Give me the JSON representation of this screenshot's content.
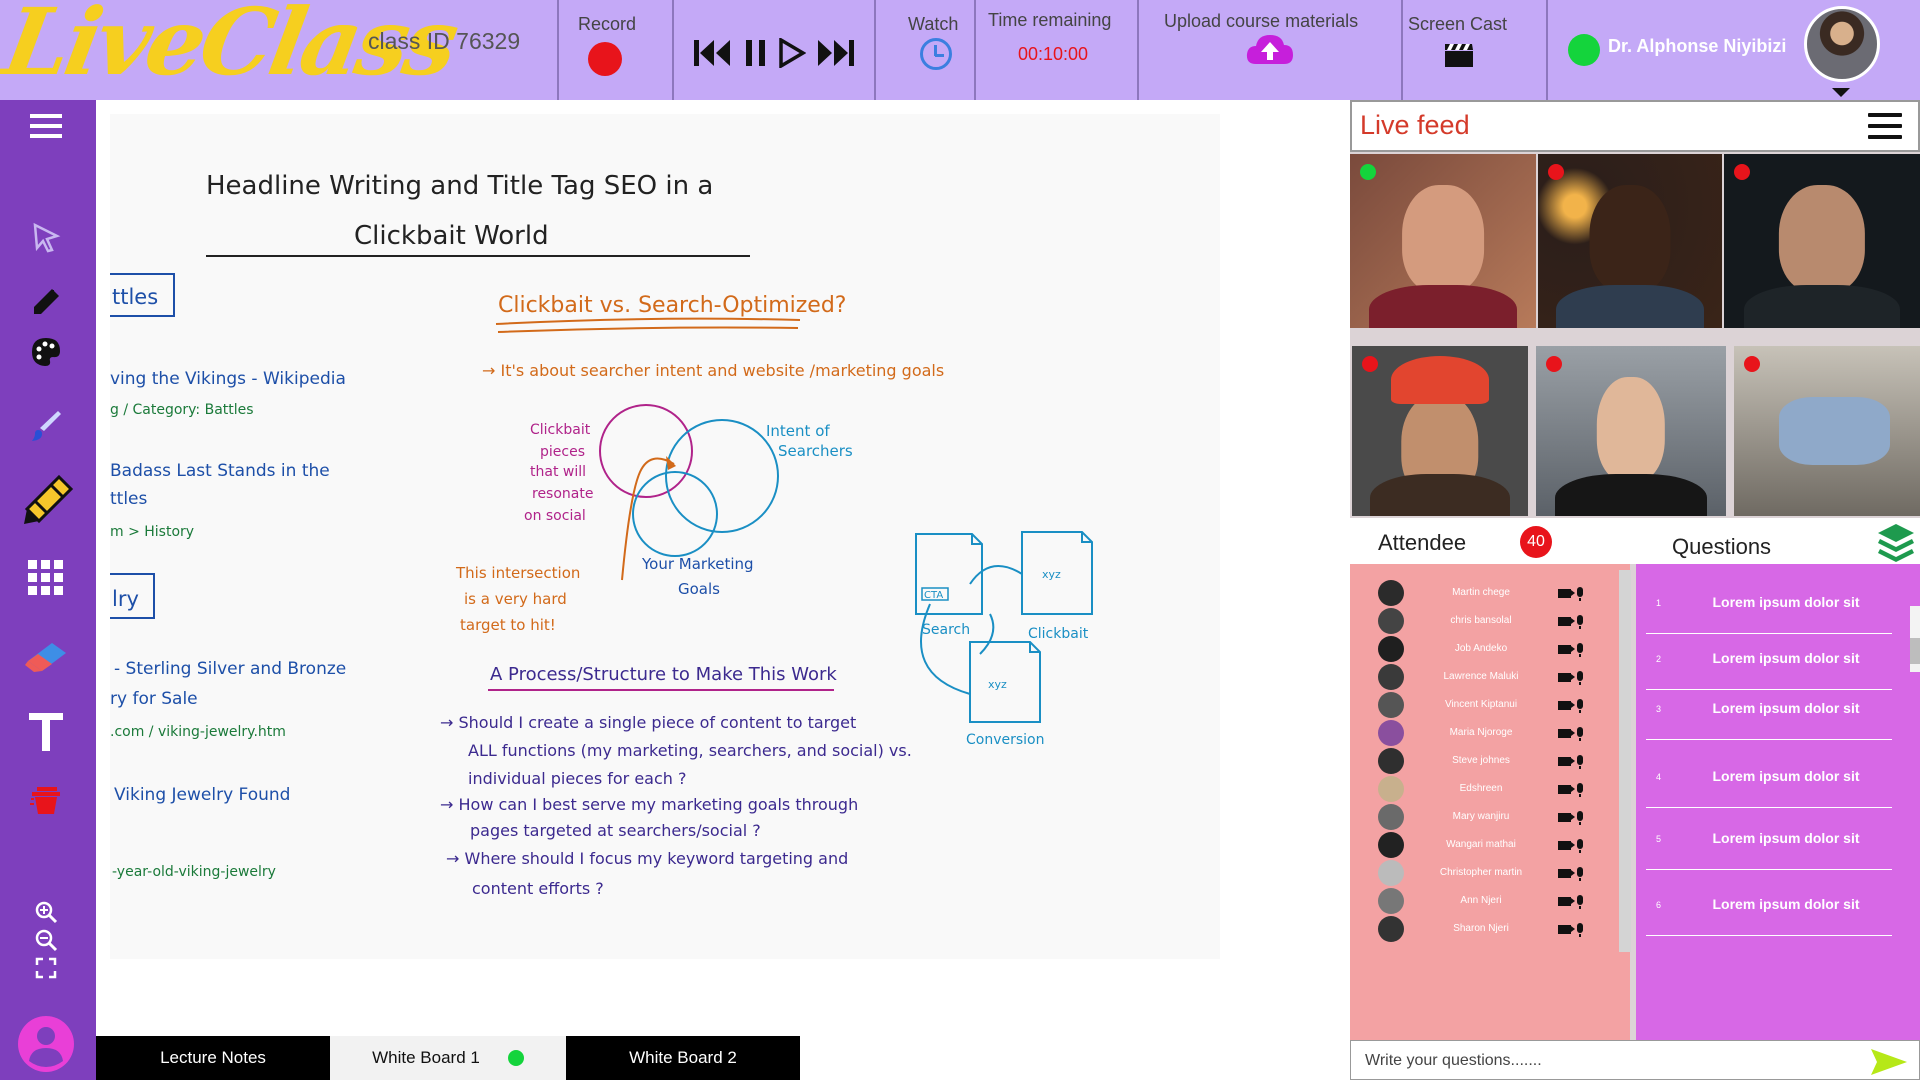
{
  "header": {
    "logo": "LiveClass",
    "class_id": "class ID 76329",
    "record_label": "Record",
    "watch_label": "Watch",
    "time_label": "Time remaining",
    "time_value": "00:10:00",
    "upload_label": "Upload  course materials",
    "screencast_label": "Screen Cast",
    "user_name": "Dr. Alphonse Niyibizi"
  },
  "colors": {
    "topbar": "#c4a9f7",
    "sidebar": "#7e3fbd",
    "logo": "#f6cf1f",
    "record": "#e8141b",
    "online": "#14d43c",
    "attendees_bg": "#f3a2a3",
    "questions_bg": "#d768e6",
    "send": "#b6e817"
  },
  "toolbar_icons": [
    "menu-icon",
    "pointer-icon",
    "pencil-icon",
    "palette-icon",
    "brush-icon",
    "crayon-icon",
    "grid-icon",
    "eraser-icon",
    "text-icon",
    "trash-icon",
    "zoom-in-icon",
    "zoom-out-icon",
    "fit-screen-icon",
    "profile-icon"
  ],
  "board": {
    "title_line1": "Headline Writing and Title Tag SEO in a",
    "title_line2": "Clickbait World",
    "left_fragments": [
      "ttles",
      "ving the Vikings - Wikipedia",
      "g / Category: Battles",
      "Badass Last Stands in the",
      "ttles",
      "m > History",
      "lry",
      "- Sterling Silver and Bronze",
      "ry for Sale",
      ".com / viking-jewelry.htm",
      "Viking Jewelry Found",
      "-year-old-viking-jewelry"
    ],
    "orange_heading": "Clickbait vs. Search-Optimized?",
    "orange_sub": "→ It's about searcher intent and website /marketing goals",
    "clickbait_label": [
      "Clickbait",
      "pieces",
      "that will",
      "resonate",
      "on social"
    ],
    "intent_label": [
      "Intent of",
      "Searchers"
    ],
    "marketing_label": [
      "Your Marketing",
      "Goals"
    ],
    "intersection_label": [
      "This intersection",
      "is a very hard",
      "target to hit!"
    ],
    "process_heading": "A Process/Structure to Make This Work",
    "bullets": [
      [
        "→ Should I create a single piece of content to target",
        "ALL functions (my marketing, searchers, and social) vs.",
        "individual pieces for each ?"
      ],
      [
        "→ How can I best serve my marketing goals through",
        "pages targeted at searchers/social ?"
      ],
      [
        "→ Where should I focus my keyword targeting and",
        "content efforts ?"
      ]
    ],
    "diagram_labels": [
      "CTA",
      "xyz",
      "Search",
      "Clickbait",
      "xyz",
      "Conversion"
    ]
  },
  "tabs": [
    {
      "label": "Lecture Notes"
    },
    {
      "label": "White Board 1"
    },
    {
      "label": "White Board 2"
    }
  ],
  "live_feed": {
    "title": "Live feed",
    "videos": [
      {
        "status": "green"
      },
      {
        "status": "red"
      },
      {
        "status": "red"
      },
      {
        "status": "red"
      },
      {
        "status": "red"
      },
      {
        "status": "red"
      }
    ]
  },
  "attendees": {
    "title": "Attendee",
    "count": "40",
    "list": [
      "Martin chege",
      "chris bansolal",
      "Job Andeko",
      "Lawrence Maluki",
      "Vincent Kiptanui",
      "Maria Njoroge",
      "Steve johnes",
      "Edshreen",
      "Mary wanjiru",
      "Wangari mathai",
      "Christopher martin",
      "Ann Njeri",
      "Sharon Njeri"
    ]
  },
  "questions": {
    "title": "Questions",
    "items": [
      {
        "num": "1",
        "text": "Lorem ipsum dolor sit"
      },
      {
        "num": "2",
        "text": "Lorem ipsum dolor sit"
      },
      {
        "num": "3",
        "text": "Lorem ipsum dolor sit"
      },
      {
        "num": "4",
        "text": "Lorem ipsum dolor sit"
      },
      {
        "num": "5",
        "text": "Lorem ipsum dolor sit"
      },
      {
        "num": "6",
        "text": "Lorem ipsum dolor sit"
      }
    ],
    "input_placeholder": "Write your questions......."
  }
}
